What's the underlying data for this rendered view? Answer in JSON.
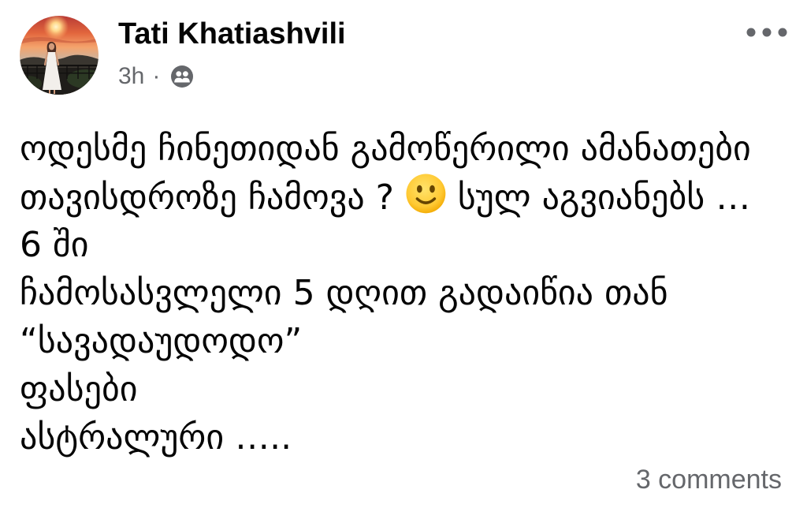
{
  "post": {
    "author": {
      "name": "Tati Khatiashvili",
      "avatar_icon": "avatar-photo"
    },
    "meta": {
      "time": "3h",
      "separator": "·",
      "audience_icon": "friends-icon"
    },
    "menu_icon": "more-options-icon",
    "body": {
      "lines": [
        {
          "text": "ოდესმე ჩინეთიდან გამოწერილი ამანათები"
        },
        {
          "segments": [
            {
              "text": "თავისდროზე ჩამოვა ? "
            },
            {
              "icon": "slightly-smiling-face-emoji"
            },
            {
              "text": " სულ აგვიანებს …"
            }
          ]
        },
        {
          "text": "6 ში"
        },
        {
          "text": "ჩამოსასვლელი 5 დღით გადაიწია თან"
        },
        {
          "text": "“სავადაუდოდო”"
        },
        {
          "text": "ფასები"
        },
        {
          "text": "ასტრალური ….."
        }
      ]
    },
    "footer": {
      "comments": "3 comments"
    }
  },
  "colors": {
    "background": "#ffffff",
    "text_primary": "#050505",
    "text_secondary": "#65676b",
    "emoji_face": "#ffcc4d",
    "emoji_features": "#664500"
  }
}
